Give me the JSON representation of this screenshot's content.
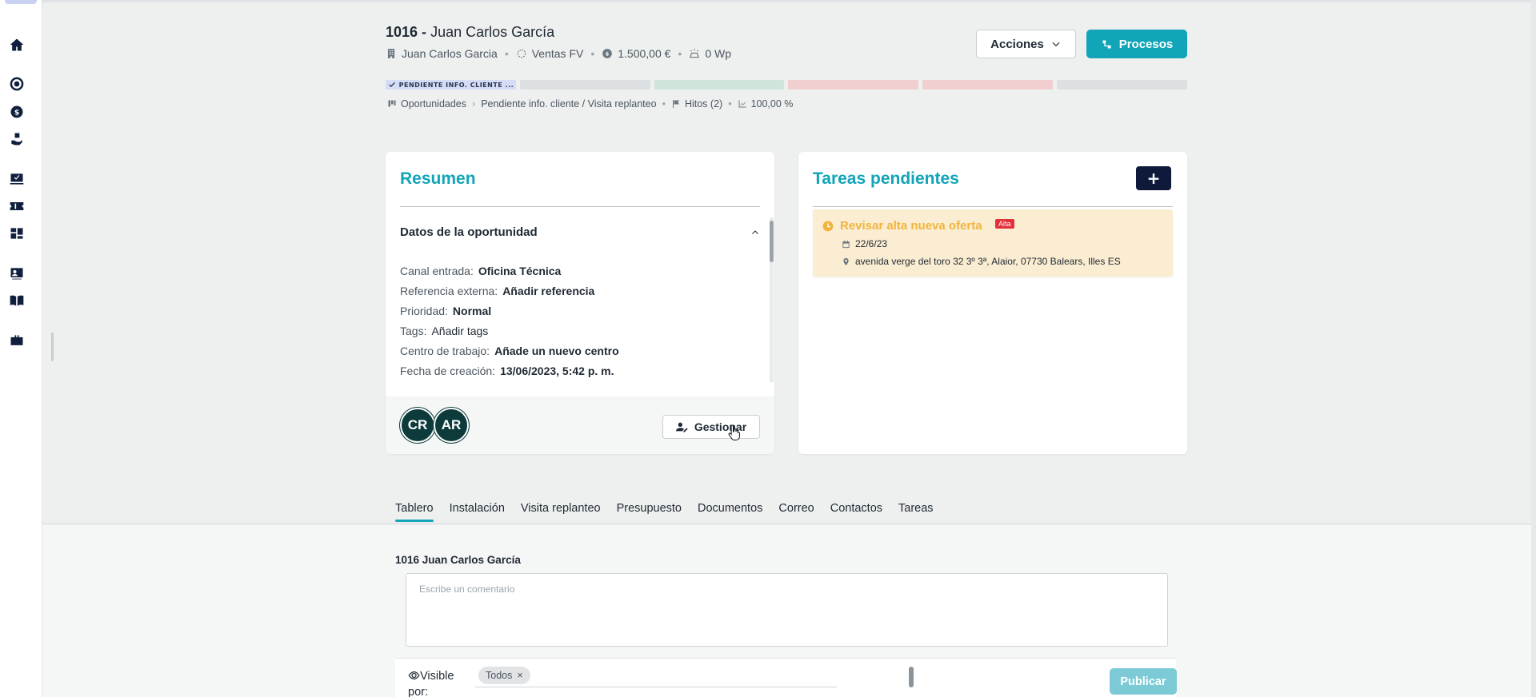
{
  "header": {
    "id": "1016 -",
    "name": "Juan Carlos García",
    "meta": {
      "company": "Juan Carlos Garcia",
      "team": "Ventas FV",
      "amount": "1.500,00 €",
      "power": "0 Wp"
    },
    "actions_label": "Acciones",
    "processes_label": "Procesos"
  },
  "progress": {
    "active_label": "PENDIENTE INFO. CLIENTE ...",
    "segments": [
      "active",
      "gray",
      "green",
      "red",
      "red",
      "gray"
    ]
  },
  "breadcrumb": {
    "pipeline": "Oportunidades",
    "stage": "Pendiente info. cliente / Visita replanteo",
    "milestones": "Hitos (2)",
    "percent": "100,00 %"
  },
  "resumen": {
    "title": "Resumen",
    "section_title": "Datos de la oportunidad",
    "fields": [
      {
        "label": "Canal entrada:",
        "value": "Oficina Técnica"
      },
      {
        "label": "Referencia externa:",
        "value": "Añadir referencia"
      },
      {
        "label": "Prioridad:",
        "value": "Normal"
      },
      {
        "label": "Tags:",
        "value": "Añadir tags"
      },
      {
        "label": "Centro de trabajo:",
        "value": "Añade un nuevo centro"
      },
      {
        "label": "Fecha de creación:",
        "value": "13/06/2023, 5:42 p. m."
      }
    ],
    "avatars": [
      "CR",
      "AR"
    ],
    "manage_label": "Gestionar"
  },
  "tareas": {
    "title": "Tareas pendientes",
    "add_label": "+",
    "task": {
      "title": "Revisar alta nueva oferta",
      "priority": "Alta",
      "date": "22/6/23",
      "address": "avenida verge del toro 32 3º 3ª, Alaior, 07730 Balears, Illes ES"
    }
  },
  "tabs": [
    "Tablero",
    "Instalación",
    "Visita replanteo",
    "Presupuesto",
    "Documentos",
    "Correo",
    "Contactos",
    "Tareas"
  ],
  "comments": {
    "title": "1016 Juan Carlos García",
    "placeholder": "Escribe un comentario",
    "visible_label_1": "Visible",
    "visible_label_2": "por:",
    "chip": "Todos",
    "chip_remove": "×",
    "publish_label": "Publicar"
  },
  "colors": {
    "accent": "#12a4b8",
    "dark": "#0f1a3a",
    "avatar": "#0d3b3c",
    "task_bg": "#fbedd1",
    "task_title": "#f0b43c",
    "badge": "#e3303b"
  }
}
